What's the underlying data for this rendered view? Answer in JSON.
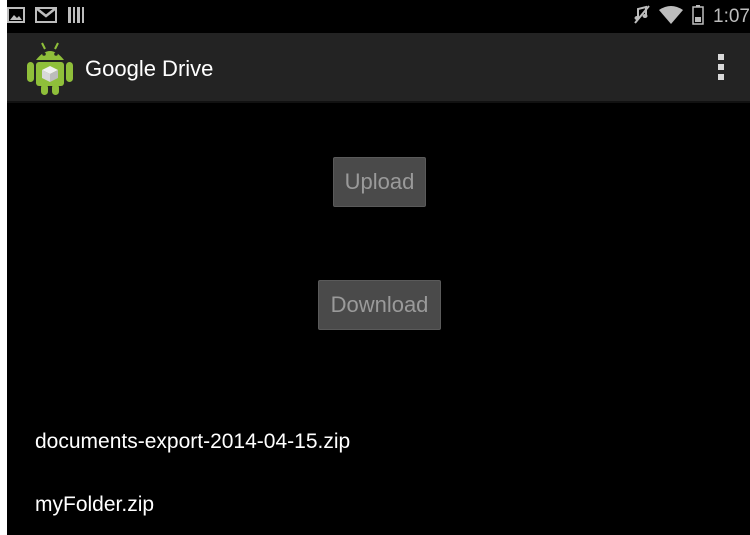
{
  "status_bar": {
    "left_icons": [
      "picture-icon",
      "gmail-icon",
      "barcode-icon"
    ],
    "right_icons": [
      "mute-icon",
      "wifi-icon",
      "battery-icon"
    ],
    "time": "1:07"
  },
  "action_bar": {
    "app_icon": "android-icon",
    "title": "Google Drive",
    "overflow_icon": "overflow-menu-icon"
  },
  "main": {
    "upload_label": "Upload",
    "download_label": "Download",
    "files": [
      "documents-export-2014-04-15.zip",
      "myFolder.zip"
    ]
  },
  "colors": {
    "background": "#000000",
    "action_bar": "#232323",
    "button": "#4a4a4a",
    "button_text": "#9a9a9a",
    "text": "#ffffff",
    "android_green": "#8fbf3a"
  }
}
